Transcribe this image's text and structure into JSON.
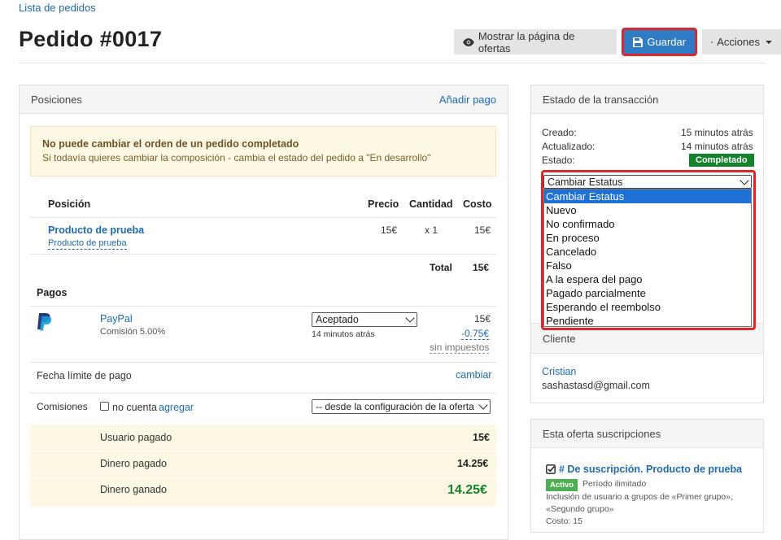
{
  "breadcrumb": "Lista de pedidos",
  "page_title": "Pedido #0017",
  "toolbar": {
    "show_offers_label": "Mostrar la página de ofertas",
    "save_label": "Guardar",
    "actions_label": "Acciones"
  },
  "positions_panel": {
    "title": "Posiciones",
    "add_payment_link": "Añadir pago",
    "warning_title": "No puede cambiar el orden de un pedido completado",
    "warning_text": "Si todavía quieres cambiar la composición - cambia el estado del pedido a \"En desarrollo\"",
    "columns": {
      "position": "Posición",
      "price": "Precio",
      "quantity": "Cantidad",
      "cost": "Costo"
    },
    "item": {
      "name": "Producto de prueba",
      "sub": "Producto de prueba",
      "price": "15€",
      "quantity": "x 1",
      "cost": "15€"
    },
    "total_label": "Total",
    "total_value": "15€"
  },
  "payments": {
    "title": "Pagos",
    "method": "PayPal",
    "commission": "Comisión 5.00%",
    "status_selected": "Aceptado",
    "status_time": "14 minutos atrás",
    "amount": "15€",
    "fee": "-0.75€",
    "no_tax_link": "sin impuestos",
    "deadline_label": "Fecha límite de pago",
    "deadline_link": "cambiar",
    "commissions_label": "Comisiones",
    "no_count_label": "no cuenta",
    "add_link": "agregar",
    "config_select": "-- desde la configuración de la oferta --",
    "summary": [
      {
        "label": "Usuario pagado",
        "value": "15€"
      },
      {
        "label": "Dinero pagado",
        "value": "14.25€"
      },
      {
        "label": "Dinero ganado",
        "value": "14.25€"
      }
    ]
  },
  "transaction": {
    "title": "Estado de la transacción",
    "created_label": "Creado:",
    "created_value": "15 minutos atrás",
    "updated_label": "Actualizado:",
    "updated_value": "14 minutos atrás",
    "state_label": "Estado:",
    "state_value": "Completado",
    "status_select": "Cambiar Estatus",
    "status_options": [
      "Cambiar Estatus",
      "Nuevo",
      "No confirmado",
      "En proceso",
      "Cancelado",
      "Falso",
      "A la espera del pago",
      "Pagado parcialmente",
      "Esperando el reembolso",
      "Pendiente"
    ]
  },
  "client": {
    "title": "Cliente",
    "name": "Cristian",
    "email": "sashastasd@gmail.com"
  },
  "subscriptions": {
    "title": "Esta oferta suscripciones",
    "item_title": "# De suscripción. Producto de prueba",
    "badge": "Activo",
    "period": "Período ilimitado",
    "desc_1": "Inclusión de usuario a grupos de «Primer grupo»,",
    "desc_2": "«Segundo grupo»",
    "cost": "Costo: 15"
  },
  "colors": {
    "link": "#1e6bb0",
    "primary": "#2f7bc4",
    "highlight": "#d9292f",
    "success": "#13822b",
    "warning_bg": "#fcf8e3",
    "money_green": "#13822b"
  }
}
